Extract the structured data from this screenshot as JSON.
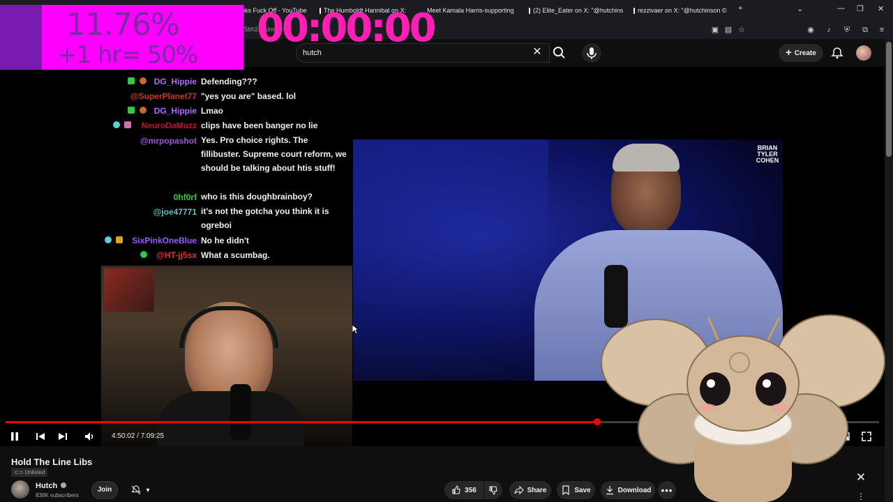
{
  "browser": {
    "tabs": [
      {
        "label": "nks Fuck Off - YouTube",
        "fav": "#ff0000"
      },
      {
        "label": "The Humboldt Hannibal on X:",
        "fav": "#ffffff"
      },
      {
        "label": "Meet Kamala Harris-supporting",
        "fav": "#6aa0ff"
      },
      {
        "label": "(2) Elite_Eater on X: \"@hutchins",
        "fav": "#ffffff"
      },
      {
        "label": "rezzivaer on X: \"@hutchinson ©",
        "fav": "#ffffff"
      }
    ],
    "address_fragment": "75bh2...&index=2"
  },
  "overlay": {
    "percent": "11.76%",
    "hour_note": "+1 hr= 50%",
    "timer": "00:00:00"
  },
  "header": {
    "search_value": "hutch",
    "create_label": "Create"
  },
  "chat": [
    {
      "name": "DG_Hippie",
      "msg": "Defending???",
      "color": "#a970ff"
    },
    {
      "name": "@SuperPlanet77",
      "msg": "\"yes you are\" based. lol",
      "color": "#c0392b"
    },
    {
      "name": "DG_Hippie",
      "msg": "Lmao",
      "color": "#a970ff"
    },
    {
      "name": "NeuroDaMuzz",
      "msg": "clips have been banger no lie",
      "color": "#c0122a"
    },
    {
      "name": "@mrpopashot",
      "msg": "Yes. Pro choice rights. The fillibuster. Supreme court reform, we should be talking about htis stuff!",
      "color": "#a050e0"
    },
    {
      "name": "0hf0rf",
      "msg": "who is this doughbrainboy?",
      "color": "#2ecc40"
    },
    {
      "name": "@joe47771",
      "msg": "it's not the gotcha you think it is ogreboi",
      "color": "#5fbfbf"
    },
    {
      "name": "SixPinkOneBlue",
      "msg": "No he didn't",
      "color": "#9b59ff"
    },
    {
      "name": "@HT-jj5sx",
      "msg": "What a scumbag.",
      "color": "#e03030"
    }
  ],
  "video_logo": {
    "line1": "BRIAN",
    "line2": "TYLER",
    "line3": "COHEN"
  },
  "player": {
    "progress": 0.677,
    "current_time": "4:50:02",
    "total_time": "7:09:25"
  },
  "video_info": {
    "title": "Hold The Line Libs",
    "visibility": "Unlisted",
    "channel": "Hutch",
    "subscribers": "838K subscribers",
    "join_label": "Join",
    "likes": "356",
    "share_label": "Share",
    "save_label": "Save",
    "download_label": "Download"
  }
}
